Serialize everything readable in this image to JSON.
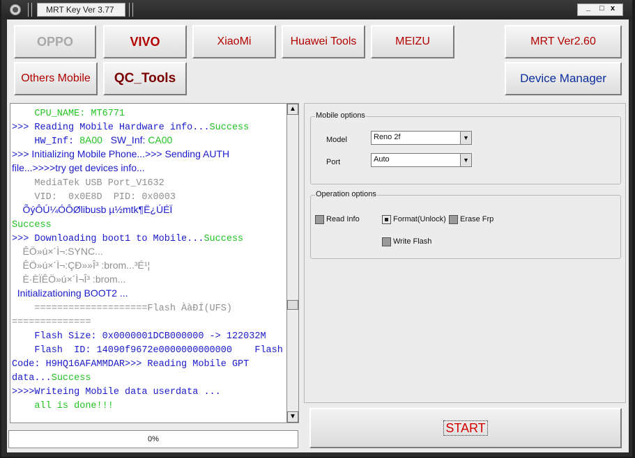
{
  "window": {
    "title": "MRT Key Ver 3.77",
    "controls": [
      "_",
      "□",
      "x"
    ]
  },
  "buttons": {
    "oppo": "OPPO",
    "vivo": "VIVO",
    "xiaomi": "XiaoMi",
    "huawei": "Huawei Tools",
    "meizu": "MEIZU",
    "mrt": "MRT Ver2.60",
    "others": "Others Mobile",
    "qc_tools": "QC_Tools",
    "device_manager": "Device Manager",
    "start": "START"
  },
  "log": {
    "lines": [
      [
        {
          "t": "    CPU_NAME: MT6771",
          "c": "green",
          "f": "mono"
        }
      ],
      [
        {
          "t": ">>> Reading Mobile Hardware info...",
          "c": "blue",
          "f": "mono"
        },
        {
          "t": "Success",
          "c": "green",
          "f": "mono"
        }
      ],
      [
        {
          "t": "    HW_Inf: ",
          "c": "blue",
          "f": "mono"
        },
        {
          "t": "8A00",
          "c": "green",
          "f": "sans"
        },
        {
          "t": "   SW_Inf: ",
          "c": "blue",
          "f": "sans"
        },
        {
          "t": "CA00",
          "c": "green",
          "f": "sans"
        }
      ],
      [
        {
          "t": ">>> Initializing Mobile Phone...>>> Sending AUTH",
          "c": "blue",
          "f": "sans"
        }
      ],
      [
        {
          "t": "file...>>>>try get devices info...",
          "c": "blue",
          "f": "sans"
        }
      ],
      [
        {
          "t": "    MediaTek USB Port_V1632",
          "c": "gray",
          "f": "mono"
        }
      ],
      [
        {
          "t": "    VID:  0x0E8D  PID: 0x0003",
          "c": "gray",
          "f": "mono"
        }
      ],
      [
        {
          "t": "    ÕýÔÚ¼ÓÔØlibusb µ½mtk¶Ë¿ÚÉÏ",
          "c": "blue",
          "f": "sans"
        }
      ],
      [
        {
          "t": "Success",
          "c": "green",
          "f": "mono"
        }
      ],
      [
        {
          "t": ">>> Downloading boot1 to Mobile...",
          "c": "blue",
          "f": "mono"
        },
        {
          "t": "Success",
          "c": "green",
          "f": "mono"
        }
      ],
      [
        {
          "t": "    ÊÖ»ú×´Ì¬:SYNC...",
          "c": "gray",
          "f": "sans"
        }
      ],
      [
        {
          "t": "    ÊÖ»ú×´Ì¬:ÇÐ»»Î³ :brom...³É¹¦",
          "c": "gray",
          "f": "sans"
        }
      ],
      [
        {
          "t": "    È·ÈÏÊÖ»ú×´Ì¬Î³ :brom...",
          "c": "gray",
          "f": "sans"
        }
      ],
      [
        {
          "t": "  Initializationing BOOT2 ...",
          "c": "blue",
          "f": "sans"
        }
      ],
      [
        {
          "t": "    ====================Flash ÀàÐÍ(UFS)",
          "c": "gray",
          "f": "mono"
        }
      ],
      [
        {
          "t": "==============",
          "c": "gray",
          "f": "mono"
        }
      ],
      [
        {
          "t": "    Flash Size: 0x0000001DCB000000 -> 122032M",
          "c": "blue",
          "f": "mono"
        }
      ],
      [
        {
          "t": "    Flash  ID: 14090f9672e0000000000000    Flash",
          "c": "blue",
          "f": "mono"
        }
      ],
      [
        {
          "t": "Code: H9HQ16AFAMMDAR>>> Reading Mobile GPT",
          "c": "blue",
          "f": "mono"
        }
      ],
      [
        {
          "t": "data...",
          "c": "blue",
          "f": "mono"
        },
        {
          "t": "Success",
          "c": "green",
          "f": "mono"
        }
      ],
      [
        {
          "t": ">>>>Writeing Mobile data userdata ...",
          "c": "blue",
          "f": "mono"
        }
      ],
      [
        {
          "t": "    all is done!!!",
          "c": "green",
          "f": "mono"
        }
      ]
    ]
  },
  "mobile_options": {
    "label": "Mobile options",
    "model_label": "Model",
    "model_value": "Reno 2f",
    "port_label": "Port",
    "port_value": "Auto"
  },
  "operation_options": {
    "label": "Operation options",
    "read_info": "Read Info",
    "format_unlock": "Format(Unlock)",
    "erase_frp": "Erase Frp",
    "write_flash": "Write Flash"
  },
  "progress": {
    "value": 0,
    "text": "0%"
  },
  "colors": {
    "green": "#22c322",
    "blue": "#1a1acc",
    "gray": "#8f8f8f",
    "dark_red": "#b30000"
  }
}
